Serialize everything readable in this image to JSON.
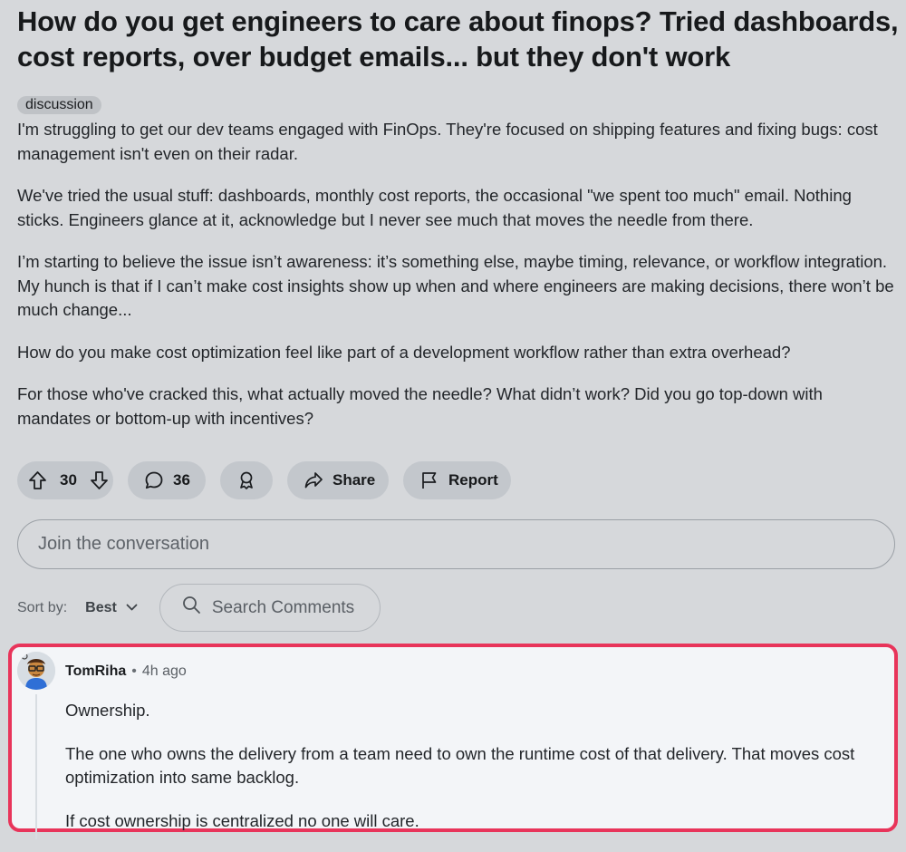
{
  "post": {
    "title": "How do you get engineers to care about finops? Tried dashboards, cost reports, over budget emails... but they don't work",
    "flair": "discussion",
    "paragraphs": [
      "I'm struggling to get our dev teams engaged with FinOps. They're focused on shipping features and fixing bugs: cost management isn't even on their radar.",
      "We've tried the usual stuff: dashboards, monthly cost reports, the occasional \"we spent too much\" email. Nothing sticks. Engineers glance at it, acknowledge but I never see much that moves the needle from there.",
      "I’m starting to believe the issue isn’t awareness: it’s something else, maybe timing, relevance, or workflow integration. My hunch is that if I can’t make cost insights show up when and where engineers are making decisions, there won’t be much change...",
      "How do you make cost optimization feel like part of a development workflow rather than extra overhead?",
      "For those who've cracked this, what actually moved the needle? What didn’t work? Did you go top-down with mandates or bottom-up with incentives?"
    ]
  },
  "actions": {
    "upvote_icon": "arrow-up-icon",
    "vote_count": "30",
    "downvote_icon": "arrow-down-icon",
    "comment_icon": "speech-bubble-icon",
    "comment_count": "36",
    "award_icon": "award-icon",
    "share_icon": "share-arrow-icon",
    "share_label": "Share",
    "report_icon": "flag-icon",
    "report_label": "Report"
  },
  "composer": {
    "placeholder": "Join the conversation"
  },
  "sort": {
    "label": "Sort by:",
    "value": "Best",
    "chevron_icon": "chevron-down-icon"
  },
  "search": {
    "icon": "search-icon",
    "placeholder": "Search Comments"
  },
  "comment": {
    "author": "TomRiha",
    "separator": "•",
    "time": "4h ago",
    "paragraphs": [
      "Ownership.",
      "The one who owns the delivery from a team need to own the runtime cost of that delivery. That moves cost optimization into same backlog.",
      "If cost ownership is centralized no one will care."
    ],
    "highlight_color": "#e8345a"
  },
  "colors": {
    "background": "#d6d8db",
    "pill": "#c3c7cc",
    "comment_background": "#f3f5f8"
  }
}
